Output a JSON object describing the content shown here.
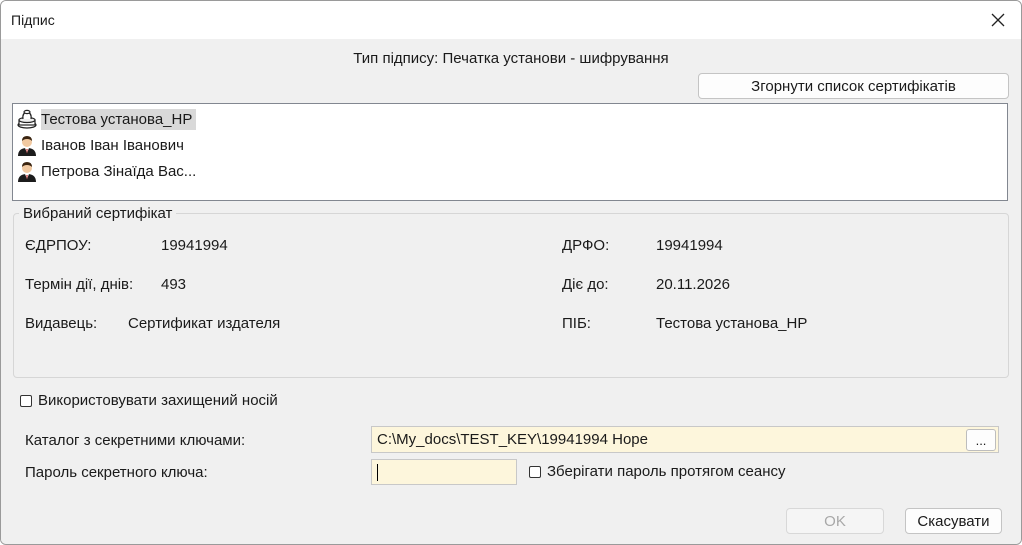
{
  "window": {
    "title": "Підпис"
  },
  "signature_type": "Тип підпису: Печатка установи - шифрування",
  "collapse_button": "Згорнути список сертифікатів",
  "certificates": [
    {
      "label": "Тестова установа_НР",
      "icon": "seal-icon",
      "selected": true
    },
    {
      "label": "Іванов Іван Іванович",
      "icon": "person-icon",
      "selected": false
    },
    {
      "label": "Петрова Зінаїда Вас...",
      "icon": "person-icon",
      "selected": false
    }
  ],
  "selected_cert": {
    "legend": "Вибраний сертифікат",
    "edrpou_label": "ЄДРПОУ:",
    "edrpou_value": "19941994",
    "drfo_label": "ДРФО:",
    "drfo_value": "19941994",
    "term_label": "Термін дії, днів:",
    "term_value": "493",
    "valid_label": "Діє до:",
    "valid_value": "20.11.2026",
    "issuer_label": "Видавець:",
    "issuer_value": "Сертификат издателя",
    "pib_label": "ПІБ:",
    "pib_value": "Тестова установа_НР"
  },
  "use_secure_media": {
    "label": "Використовувати захищений носій",
    "checked": false
  },
  "keys_catalog": {
    "label": "Каталог з секретними ключами:",
    "value": "C:\\My_docs\\TEST_KEY\\19941994 Hope",
    "browse_label": "..."
  },
  "password": {
    "label": "Пароль секретного ключа:",
    "value": ""
  },
  "save_password": {
    "label": "Зберігати пароль протягом сеансу",
    "checked": false
  },
  "ok_label": "OK",
  "cancel_label": "Скасувати"
}
